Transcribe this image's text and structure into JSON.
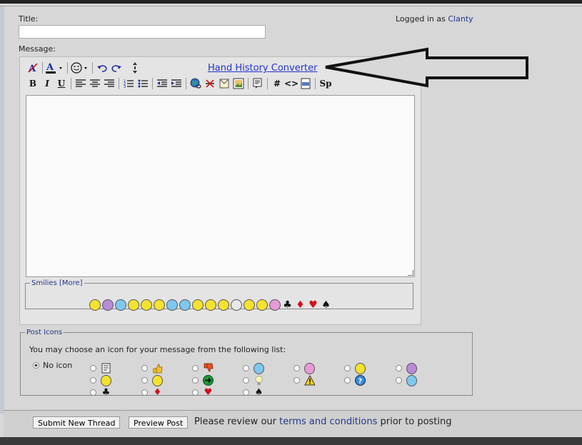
{
  "form": {
    "title_label": "Title:",
    "title_value": "",
    "message_label": "Message:",
    "logged_in_prefix": "Logged in as ",
    "username": "Clanty"
  },
  "editor": {
    "hand_history_link": "Hand History Converter",
    "toolbar": {
      "bold": "B",
      "italic": "I",
      "underline": "U",
      "hash": "#",
      "code": "<>",
      "sp": "Sp"
    },
    "smilies_legend": "Smilies",
    "smilies_more": "[More]",
    "smilie_suits": [
      "♣",
      "♦",
      "♥",
      "♠"
    ]
  },
  "post_icons": {
    "legend": "Post Icons",
    "description": "You may choose an icon for your message from the following list:",
    "no_icon_label": "No icon",
    "row3_suits": [
      "♣",
      "♦",
      "♥",
      "♠"
    ]
  },
  "footer": {
    "submit_label": "Submit New Thread",
    "preview_label": "Preview Post",
    "review_pre": "Please review our ",
    "terms_link": "terms and conditions",
    "review_post": " prior to posting"
  },
  "colors": {
    "link": "#22368a",
    "hand_history_link": "#2233cc",
    "page_bg": "#d7d7d7",
    "heart": "#d0101a"
  }
}
